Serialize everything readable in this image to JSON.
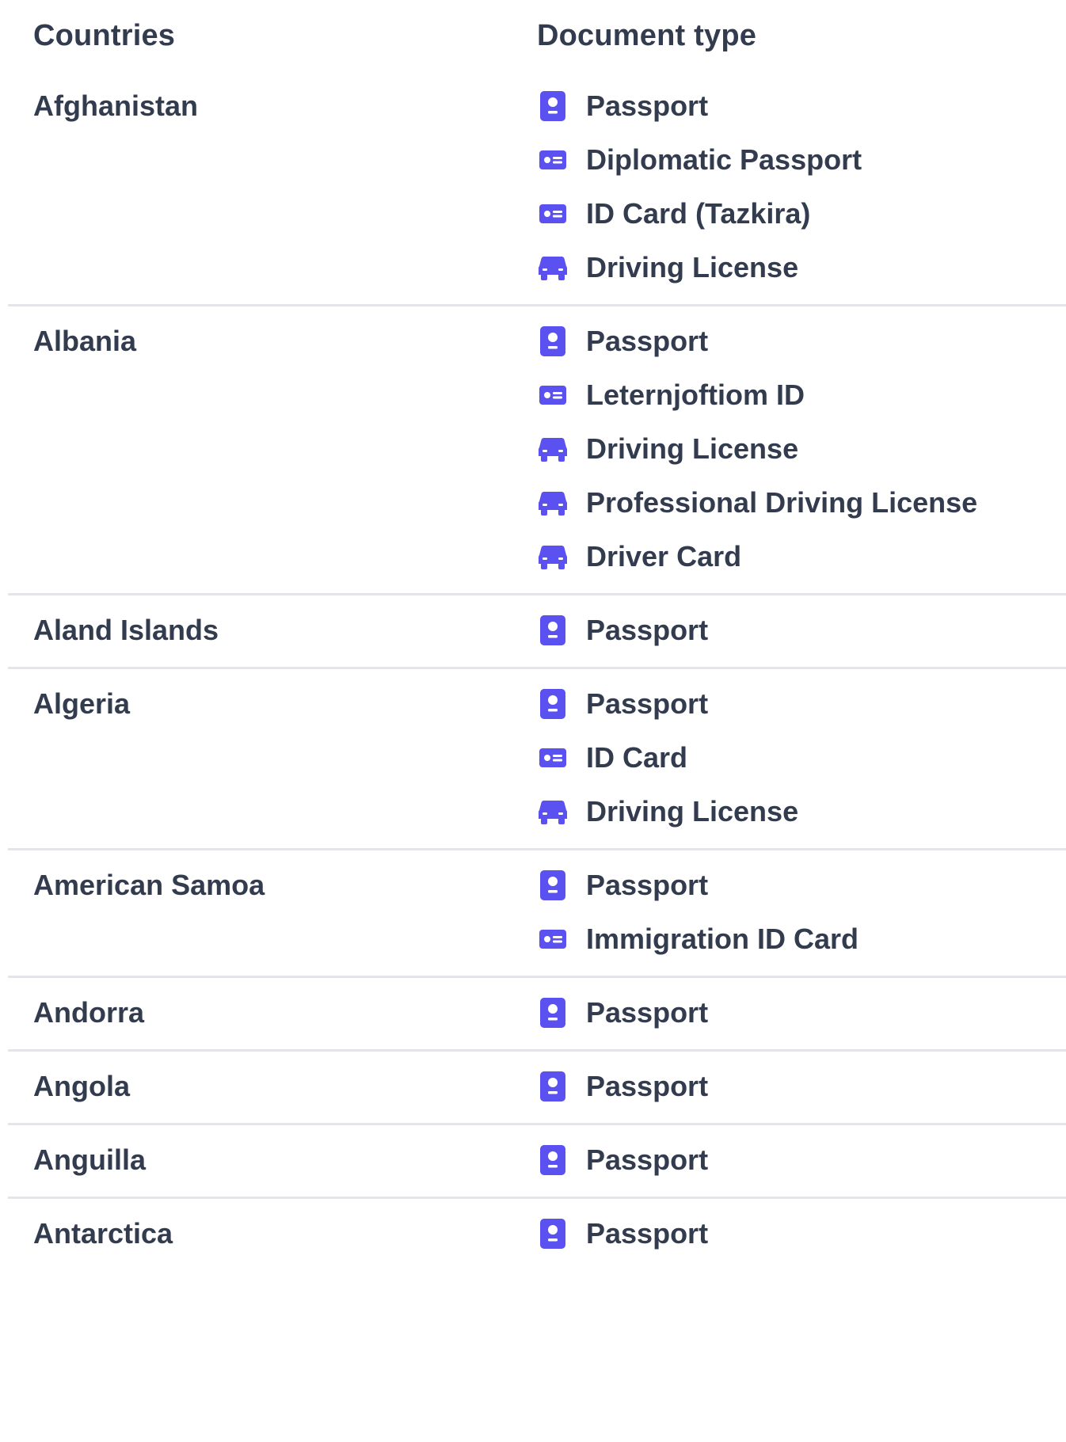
{
  "header": {
    "countries": "Countries",
    "document_type": "Document type"
  },
  "colors": {
    "icon": "#5b50f0",
    "text": "#333c4e",
    "divider": "#e3e5ea"
  },
  "rows": [
    {
      "country": "Afghanistan",
      "docs": [
        {
          "icon": "passport-icon",
          "label": "Passport"
        },
        {
          "icon": "id-card-icon",
          "label": "Diplomatic Passport"
        },
        {
          "icon": "id-card-icon",
          "label": "ID Card (Tazkira)"
        },
        {
          "icon": "car-icon",
          "label": "Driving License"
        }
      ]
    },
    {
      "country": "Albania",
      "docs": [
        {
          "icon": "passport-icon",
          "label": "Passport"
        },
        {
          "icon": "id-card-icon",
          "label": "Leternjoftiom ID"
        },
        {
          "icon": "car-icon",
          "label": "Driving License"
        },
        {
          "icon": "car-icon",
          "label": "Professional Driving License"
        },
        {
          "icon": "car-icon",
          "label": "Driver Card"
        }
      ]
    },
    {
      "country": "Aland Islands",
      "docs": [
        {
          "icon": "passport-icon",
          "label": "Passport"
        }
      ]
    },
    {
      "country": "Algeria",
      "docs": [
        {
          "icon": "passport-icon",
          "label": "Passport"
        },
        {
          "icon": "id-card-icon",
          "label": "ID Card"
        },
        {
          "icon": "car-icon",
          "label": "Driving License"
        }
      ]
    },
    {
      "country": "American Samoa",
      "docs": [
        {
          "icon": "passport-icon",
          "label": "Passport"
        },
        {
          "icon": "id-card-icon",
          "label": "Immigration ID Card"
        }
      ]
    },
    {
      "country": "Andorra",
      "docs": [
        {
          "icon": "passport-icon",
          "label": "Passport"
        }
      ]
    },
    {
      "country": "Angola",
      "docs": [
        {
          "icon": "passport-icon",
          "label": "Passport"
        }
      ]
    },
    {
      "country": "Anguilla",
      "docs": [
        {
          "icon": "passport-icon",
          "label": "Passport"
        }
      ]
    },
    {
      "country": "Antarctica",
      "docs": [
        {
          "icon": "passport-icon",
          "label": "Passport"
        }
      ]
    }
  ]
}
